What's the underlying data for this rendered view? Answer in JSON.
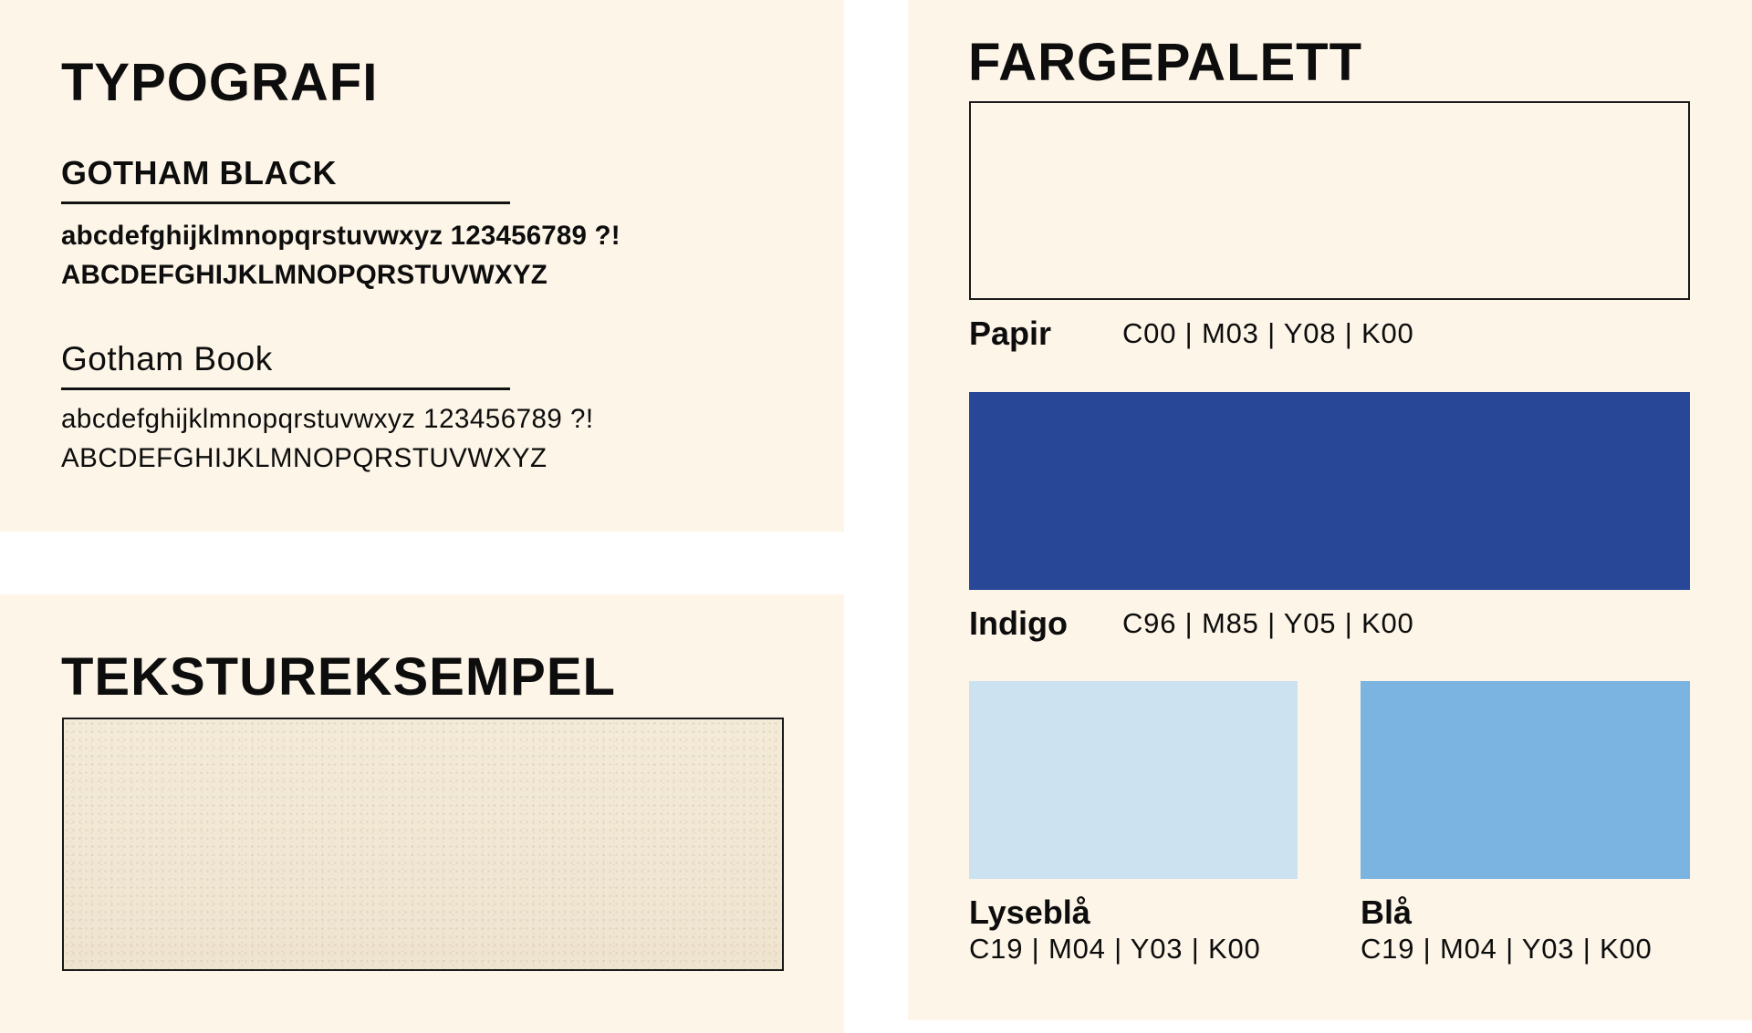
{
  "typography": {
    "heading": "TYPOGRAFI",
    "fonts": [
      {
        "name": "GOTHAM BLACK",
        "lowercase": "abcdefghijklmnopqrstuvwxyz 123456789 ?!",
        "uppercase": "ABCDEFGHIJKLMNOPQRSTUVWXYZ"
      },
      {
        "name": "Gotham Book",
        "lowercase": "abcdefghijklmnopqrstuvwxyz 123456789 ?!",
        "uppercase": "ABCDEFGHIJKLMNOPQRSTUVWXYZ"
      }
    ]
  },
  "texture": {
    "heading": "TEKSTUREKSEMPEL"
  },
  "palette": {
    "heading": "FARGEPALETT",
    "colors": [
      {
        "name": "Papir",
        "code": "C00 | M03 | Y08 | K00",
        "hex": "#fdf5e8"
      },
      {
        "name": "Indigo",
        "code": "C96 | M85 | Y05 | K00",
        "hex": "#294797"
      },
      {
        "name": "Lyseblå",
        "code": "C19 | M04 | Y03 | K00",
        "hex": "#cce2f1"
      },
      {
        "name": "Blå",
        "code": "C19 | M04 | Y03 | K00",
        "hex": "#7bb4e0"
      }
    ]
  }
}
